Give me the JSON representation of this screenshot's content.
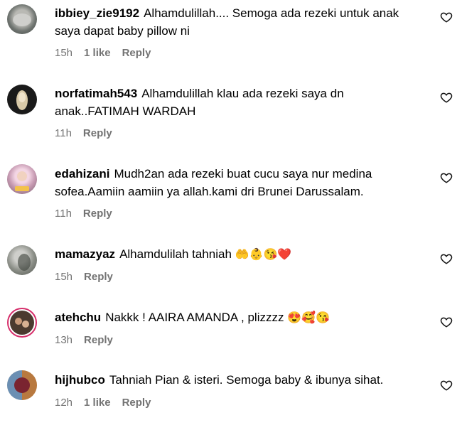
{
  "comments": [
    {
      "username": "ibbiey_zie9192",
      "text": "Alhamdulillah.... Semoga ada rezeki untuk anak saya dapat baby pillow ni",
      "time": "15h",
      "likes": "1 like",
      "reply": "Reply"
    },
    {
      "username": "norfatimah543",
      "text": "Alhamdulillah klau ada rezeki saya dn anak..FATIMAH WARDAH",
      "time": "11h",
      "likes": "",
      "reply": "Reply"
    },
    {
      "username": "edahizani",
      "text": "Mudh2an ada rezeki buat cucu saya nur medina sofea.Aamiin aamiin ya allah.kami dri Brunei Darussalam.",
      "time": "11h",
      "likes": "",
      "reply": "Reply"
    },
    {
      "username": "mamazyaz",
      "text": "Alhamdulilah tahniah",
      "emojis": "🤲👶😘❤️",
      "time": "15h",
      "likes": "",
      "reply": "Reply"
    },
    {
      "username": "atehchu",
      "text": "Nakkk ! AAIRA AMANDA , plizzzz",
      "emojis": "😍🥰😘",
      "time": "13h",
      "likes": "",
      "reply": "Reply"
    },
    {
      "username": "hijhubco",
      "text": "Tahniah Pian & isteri. Semoga baby & ibunya sihat.",
      "time": "12h",
      "likes": "1 like",
      "reply": "Reply"
    }
  ],
  "icons": {
    "like": "heart-outline-icon"
  },
  "colors": {
    "meta": "#737373",
    "text": "#000000"
  }
}
